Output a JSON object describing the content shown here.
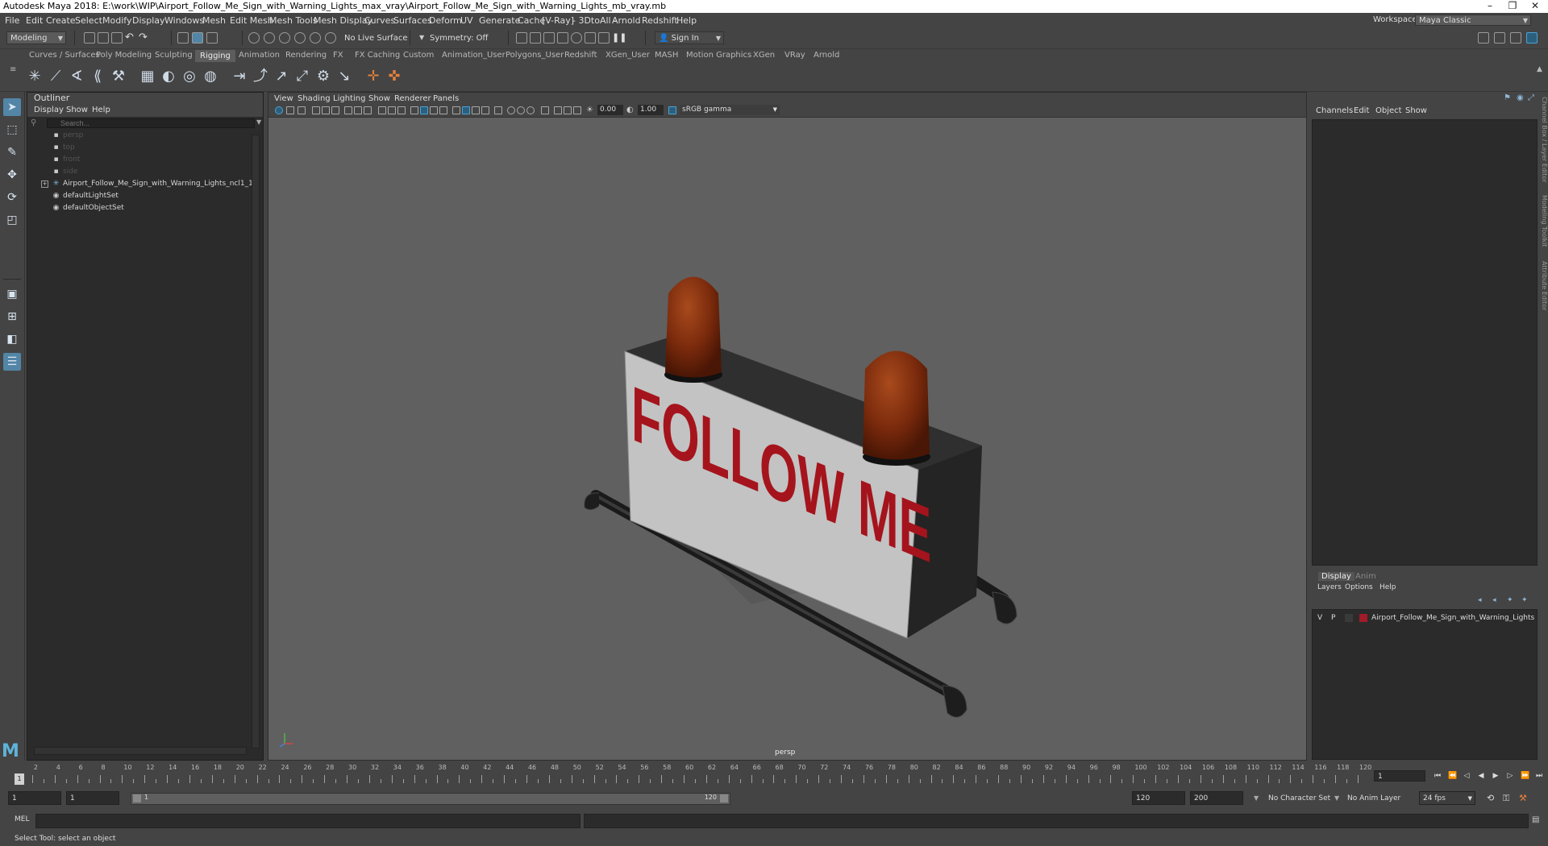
{
  "window": {
    "title": "Autodesk Maya 2018: E:\\work\\WIP\\Airport_Follow_Me_Sign_with_Warning_Lights_max_vray\\Airport_Follow_Me_Sign_with_Warning_Lights_mb_vray.mb",
    "controls": {
      "minimize": "–",
      "restore": "❐",
      "close": "✕"
    }
  },
  "menubar": {
    "items": [
      "File",
      "Edit",
      "Create",
      "Select",
      "Modify",
      "Display",
      "Windows",
      "Mesh",
      "Edit Mesh",
      "Mesh Tools",
      "Mesh Display",
      "Curves",
      "Surfaces",
      "Deform",
      "UV",
      "Generate",
      "Cache",
      "[V-Ray]",
      "- 3DtoAll -",
      "Arnold",
      "Redshift",
      "Help"
    ],
    "workspace_label": "Workspace :",
    "workspace_value": "Maya Classic"
  },
  "statusline": {
    "mode": "Modeling",
    "live_surface": "No Live Surface",
    "symmetry": "Symmetry: Off",
    "sign_in": "Sign In"
  },
  "shelf": {
    "tabs": [
      "Curves / Surfaces",
      "Poly Modeling",
      "Sculpting",
      "Rigging",
      "Animation",
      "Rendering",
      "FX",
      "FX Caching",
      "Custom",
      "Animation_User",
      "Polygons_User",
      "Redshift",
      "XGen_User",
      "MASH",
      "Motion Graphics",
      "XGen",
      "VRay",
      "Arnold"
    ],
    "active_tab": "Rigging",
    "icons": [
      "joint-icon",
      "ik-handle-icon",
      "ik-spline-icon",
      "bind-skin-icon",
      "paint-weights-icon",
      "lattice-icon",
      "cluster-icon",
      "wrap-icon",
      "blendshape-icon",
      "constraint-point-icon",
      "constraint-orient-icon",
      "constraint-aim-icon",
      "constraint-scale-icon",
      "constraint-parent-icon",
      "pole-vector-icon",
      "locator-icon",
      "curve-icon"
    ]
  },
  "outliner": {
    "title": "Outliner",
    "menu": [
      "Display",
      "Show",
      "Help"
    ],
    "search_placeholder": "Search...",
    "rows": [
      {
        "label": "persp",
        "icon": "camera-icon",
        "dim": true
      },
      {
        "label": "top",
        "icon": "camera-icon",
        "dim": true
      },
      {
        "label": "front",
        "icon": "camera-icon",
        "dim": true
      },
      {
        "label": "side",
        "icon": "camera-icon",
        "dim": true
      },
      {
        "label": "Airport_Follow_Me_Sign_with_Warning_Lights_ncl1_1",
        "icon": "group-icon",
        "dim": false,
        "expander": "+"
      },
      {
        "label": "defaultLightSet",
        "icon": "set-icon",
        "dim": false
      },
      {
        "label": "defaultObjectSet",
        "icon": "set-icon",
        "dim": false
      }
    ]
  },
  "viewport": {
    "menu": [
      "View",
      "Shading",
      "Lighting",
      "Show",
      "Renderer",
      "Panels"
    ],
    "exposure": "0.00",
    "gamma": "1.00",
    "colorspace": "sRGB gamma",
    "camera_label": "persp",
    "sign_text": "FOLLOW ME"
  },
  "channelbox": {
    "menu": [
      "Channels",
      "Edit",
      "Object",
      "Show"
    ],
    "side_tabs": [
      "Channel Box / Layer Editor",
      "Modeling Toolkit",
      "Attribute Editor"
    ]
  },
  "layer_editor": {
    "tabs": [
      "Display",
      "Anim"
    ],
    "active_tab": "Display",
    "menu": [
      "Layers",
      "Options",
      "Help"
    ],
    "layer": {
      "v": "V",
      "p": "P",
      "name": "Airport_Follow_Me_Sign_with_Warning_Lights",
      "color": "#a11b2a"
    }
  },
  "timeslider": {
    "labels": [
      "2",
      "4",
      "6",
      "8",
      "10",
      "12",
      "14",
      "16",
      "18",
      "20",
      "22",
      "24",
      "26",
      "28",
      "30",
      "32",
      "34",
      "36",
      "38",
      "40",
      "42",
      "44",
      "46",
      "48",
      "50",
      "52",
      "54",
      "56",
      "58",
      "60",
      "62",
      "64",
      "66",
      "68",
      "70",
      "72",
      "74",
      "76",
      "78",
      "80",
      "82",
      "84",
      "86",
      "88",
      "90",
      "92",
      "94",
      "96",
      "98",
      "100",
      "102",
      "104",
      "106",
      "108",
      "110",
      "112",
      "114",
      "116",
      "118",
      "120"
    ],
    "current_frame": "1",
    "current_marker": "1"
  },
  "rangeslider": {
    "start": "1",
    "start2": "1",
    "range_start": "1",
    "range_end": "120",
    "end": "120",
    "end2": "200",
    "character_set": "No Character Set",
    "anim_layer": "No Anim Layer",
    "fps": "24 fps"
  },
  "commandline": {
    "label": "MEL"
  },
  "helpline": {
    "text": "Select Tool: select an object"
  }
}
